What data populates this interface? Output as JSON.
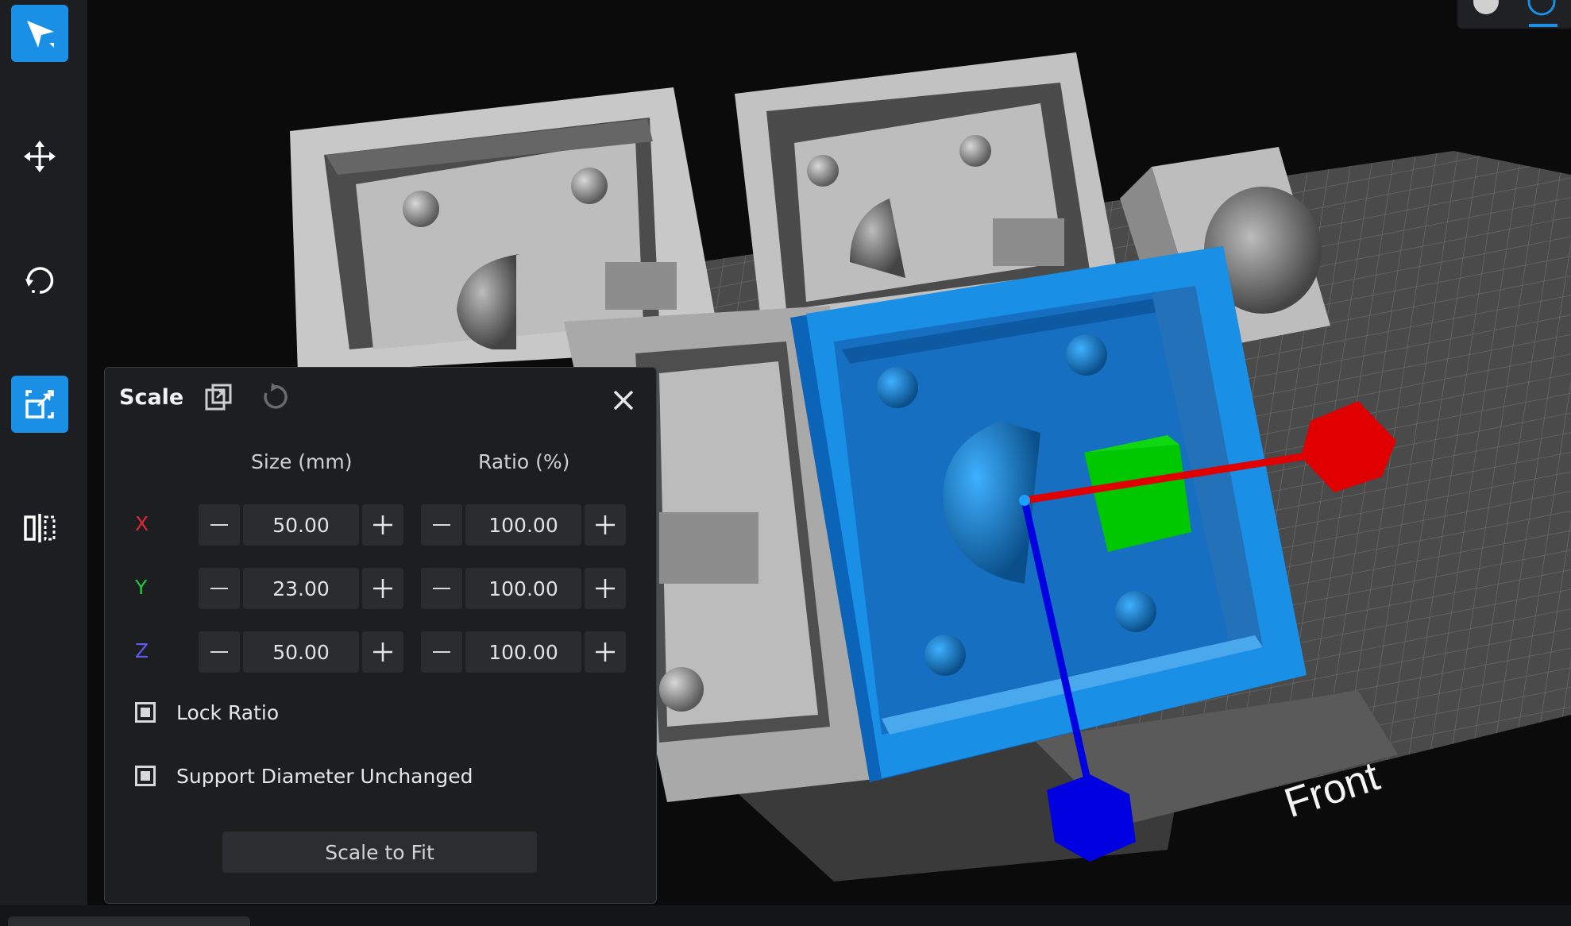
{
  "toolbar": {
    "tools": [
      {
        "name": "select",
        "icon": "cursor-arrow-icon",
        "active": true
      },
      {
        "name": "move",
        "icon": "move-arrows-icon",
        "active": false
      },
      {
        "name": "rotate",
        "icon": "rotate-icon",
        "active": false
      },
      {
        "name": "scale",
        "icon": "scale-icon",
        "active": true
      },
      {
        "name": "mirror",
        "icon": "mirror-icon",
        "active": false
      }
    ]
  },
  "viewport": {
    "front_label": "Front",
    "axis_colors": {
      "x": "#e00000",
      "y": "#00c800",
      "z": "#0000e0"
    },
    "selected_model_color": "#1a8fe6"
  },
  "scale_panel": {
    "title": "Scale",
    "size_header": "Size (mm)",
    "ratio_header": "Ratio (%)",
    "rows": [
      {
        "axis": "X",
        "color": "#e0283a",
        "size": "50.00",
        "ratio": "100.00"
      },
      {
        "axis": "Y",
        "color": "#1ec83c",
        "size": "23.00",
        "ratio": "100.00"
      },
      {
        "axis": "Z",
        "color": "#5b5bf0",
        "size": "50.00",
        "ratio": "100.00"
      }
    ],
    "lock_ratio_label": "Lock Ratio",
    "support_label": "Support Diameter Unchanged",
    "scale_to_fit_label": "Scale to Fit"
  }
}
